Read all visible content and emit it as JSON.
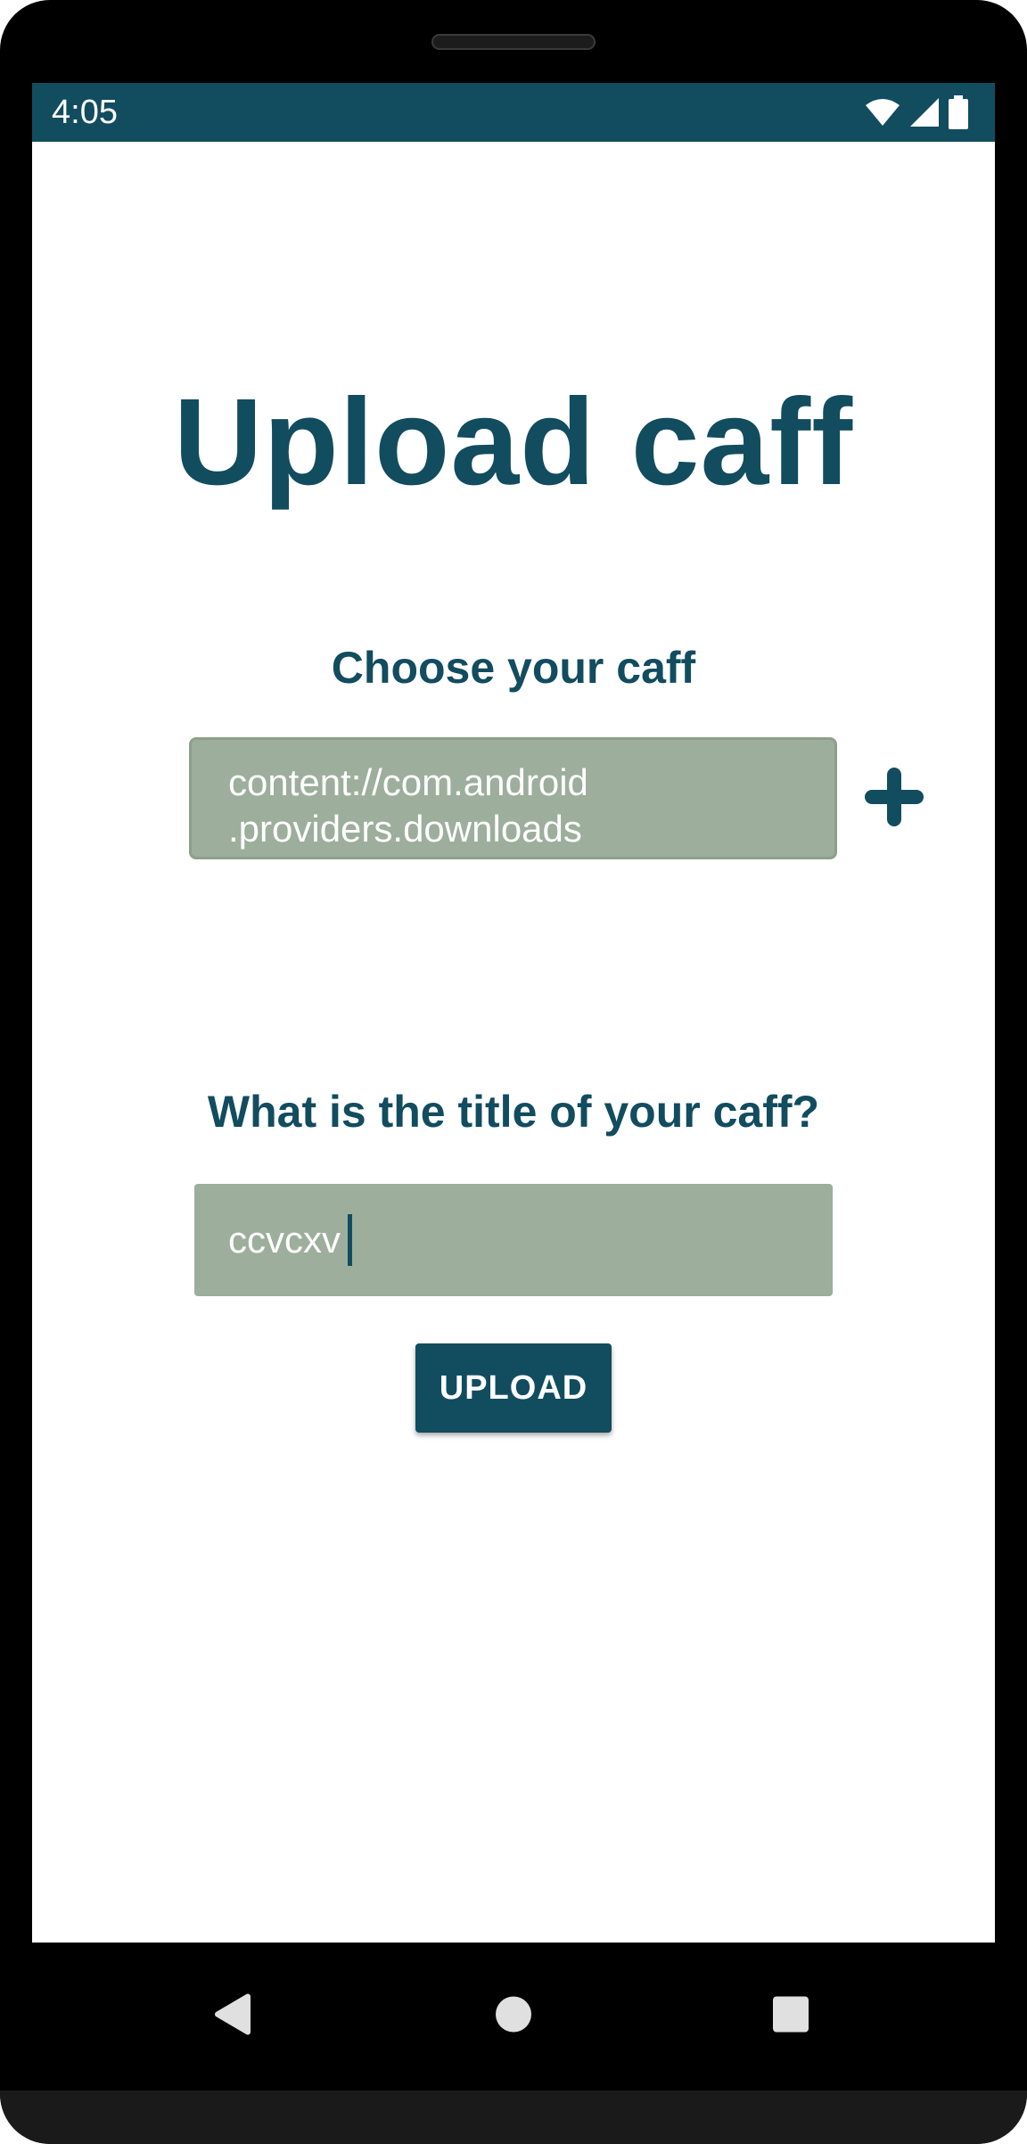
{
  "status_bar": {
    "time": "4:05",
    "icons": [
      "wifi-icon",
      "cell-signal-icon",
      "battery-icon"
    ],
    "background_color": "#124c5f"
  },
  "page": {
    "title": "Upload caff"
  },
  "file_section": {
    "label": "Choose your caff",
    "selected_file": "content://com.android\n.providers.downloads",
    "add_icon": "plus-icon"
  },
  "title_section": {
    "label": "What is the title of your caff?",
    "input_value": "ccvcxv"
  },
  "upload_button": {
    "label": "UPLOAD"
  },
  "navigation": {
    "icons": [
      "back-icon",
      "home-icon",
      "recents-icon"
    ]
  },
  "colors": {
    "primary": "#124c5f",
    "field_background": "#9dae9c",
    "text_on_field": "#ffffff"
  }
}
